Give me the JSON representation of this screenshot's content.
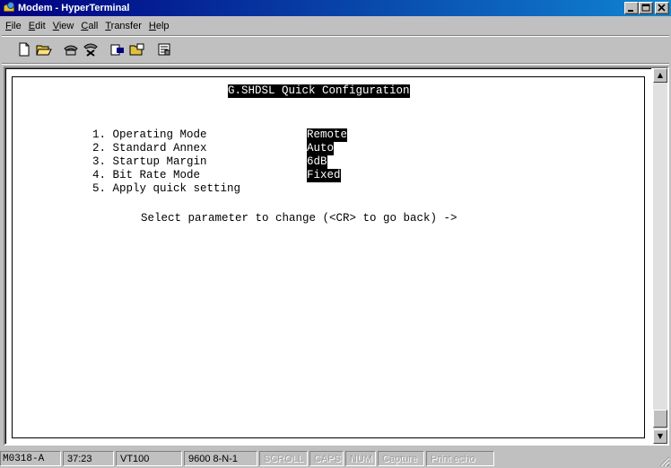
{
  "window": {
    "title": "Modem - HyperTerminal"
  },
  "menu": [
    {
      "label": "File",
      "key": "F",
      "rest": "ile"
    },
    {
      "label": "Edit",
      "key": "E",
      "rest": "dit"
    },
    {
      "label": "View",
      "key": "V",
      "rest": "iew"
    },
    {
      "label": "Call",
      "key": "C",
      "rest": "all"
    },
    {
      "label": "Transfer",
      "key": "T",
      "rest": "ransfer"
    },
    {
      "label": "Help",
      "key": "H",
      "rest": "elp"
    }
  ],
  "toolbar": {
    "icons": [
      "new-icon",
      "open-icon",
      "connect-icon",
      "disconnect-icon",
      "send-icon",
      "receive-icon",
      "properties-icon"
    ]
  },
  "terminal": {
    "title": "G.SHDSL Quick Configuration",
    "items": [
      {
        "label": "1. Operating Mode",
        "value": "Remote"
      },
      {
        "label": "2. Standard Annex",
        "value": "Auto"
      },
      {
        "label": "3. Startup Margin",
        "value": "6dB"
      },
      {
        "label": "4. Bit Rate Mode",
        "value": "Fixed"
      },
      {
        "label": "5. Apply quick setting",
        "value": ""
      }
    ],
    "prompt": "Select parameter to change (<CR> to go back) ->"
  },
  "status": {
    "host": "M0318-A",
    "time": "37:23",
    "emulation": "VT100",
    "port": "9600 8-N-1",
    "scroll": "SCROLL",
    "caps": "CAPS",
    "num": "NUM",
    "capture": "Capture",
    "print_echo": "Print echo"
  },
  "colors": {
    "title_start": "#000080",
    "title_end": "#1084d0",
    "chrome": "#c0c0c0"
  }
}
